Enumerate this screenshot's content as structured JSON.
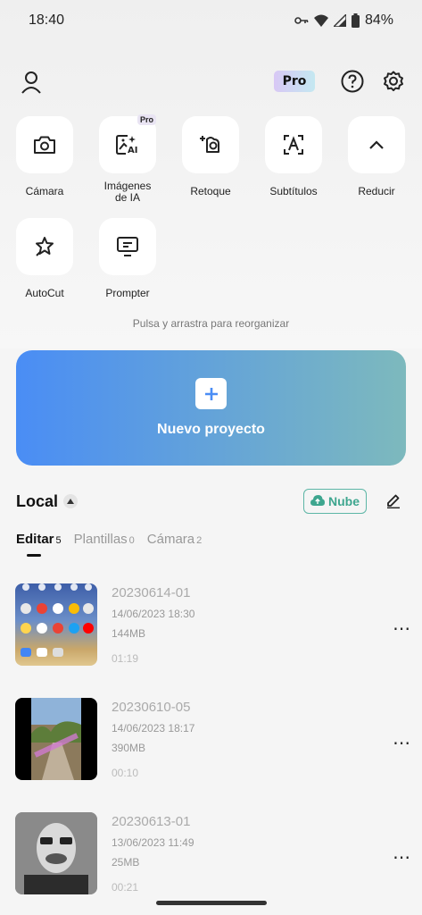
{
  "status": {
    "time": "18:40",
    "battery": "84%"
  },
  "header": {
    "pro_badge": "Pro"
  },
  "tools": [
    {
      "label": "Cámara",
      "icon": "camera-icon"
    },
    {
      "label": "Imágenes de IA",
      "icon": "ai-image-icon",
      "badge": "Pro"
    },
    {
      "label": "Retoque",
      "icon": "retouch-icon"
    },
    {
      "label": "Subtítulos",
      "icon": "subtitles-icon"
    },
    {
      "label": "Reducir",
      "icon": "chevron-up-icon"
    },
    {
      "label": "AutoCut",
      "icon": "autocut-icon"
    },
    {
      "label": "Prompter",
      "icon": "prompter-icon"
    }
  ],
  "hint": "Pulsa y arrastra para reorganizar",
  "new_project": {
    "label": "Nuevo proyecto"
  },
  "local": {
    "title": "Local",
    "cloud_button": "Nube"
  },
  "tabs": [
    {
      "label": "Editar",
      "count": "5",
      "active": true
    },
    {
      "label": "Plantillas",
      "count": "0",
      "active": false
    },
    {
      "label": "Cámara",
      "count": "2",
      "active": false
    }
  ],
  "projects": [
    {
      "name": "20230614-01",
      "date": "14/06/2023 18:30",
      "size": "144MB",
      "duration": "01:19"
    },
    {
      "name": "20230610-05",
      "date": "14/06/2023 18:17",
      "size": "390MB",
      "duration": "00:10"
    },
    {
      "name": "20230613-01",
      "date": "13/06/2023 11:49",
      "size": "25MB",
      "duration": "00:21"
    }
  ]
}
